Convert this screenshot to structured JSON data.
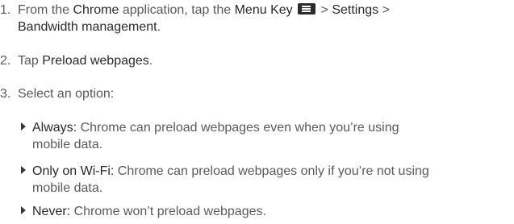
{
  "steps": [
    {
      "num": "1.",
      "t1": "From the ",
      "b1": "Chrome",
      "t2": " application, tap the ",
      "b2": "Menu Key",
      "t3": " > ",
      "b3": "Settings",
      "t4": " >",
      "b4": "Bandwidth management",
      "t5": "."
    },
    {
      "num": "2.",
      "t1": "Tap ",
      "b1": "Preload webpages",
      "t2": "."
    },
    {
      "num": "3.",
      "t1": "Select an option:"
    }
  ],
  "options": [
    {
      "label": "Always:",
      "line1": " Chrome can preload webpages even when you’re using",
      "line2": "mobile data."
    },
    {
      "label": "Only on Wi-Fi:",
      "line1": " Chrome can preload webpages only if you’re not using",
      "line2": "mobile data."
    },
    {
      "label": "Never:",
      "line1": " Chrome won’t preload webpages."
    }
  ],
  "icons": {
    "menu_key": "menu-key-icon",
    "bullet": "triangle-bullet-icon"
  }
}
